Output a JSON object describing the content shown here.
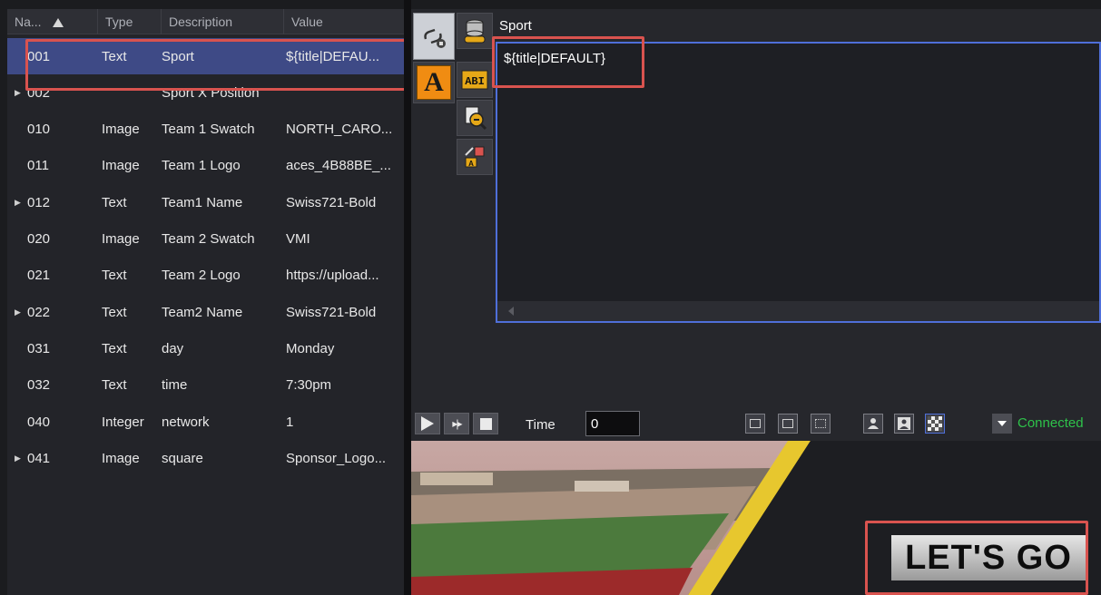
{
  "table": {
    "headers": {
      "name": "Na...",
      "type": "Type",
      "description": "Description",
      "value": "Value"
    },
    "rows": [
      {
        "name": "001",
        "expandable": false,
        "type": "Text",
        "description": "Sport",
        "value": "${title|DEFAU..."
      },
      {
        "name": "002",
        "expandable": true,
        "type": "",
        "description": "Sport X Position",
        "value": ""
      },
      {
        "name": "010",
        "expandable": false,
        "type": "Image",
        "description": "Team 1 Swatch",
        "value": "NORTH_CARO..."
      },
      {
        "name": "011",
        "expandable": false,
        "type": "Image",
        "description": "Team 1 Logo",
        "value": "aces_4B88BE_..."
      },
      {
        "name": "012",
        "expandable": true,
        "type": "Text",
        "description": "Team1 Name",
        "value": "Swiss721-Bold"
      },
      {
        "name": "020",
        "expandable": false,
        "type": "Image",
        "description": "Team 2 Swatch",
        "value": "VMI"
      },
      {
        "name": "021",
        "expandable": false,
        "type": "Text",
        "description": "Team 2 Logo",
        "value": "https://upload..."
      },
      {
        "name": "022",
        "expandable": true,
        "type": "Text",
        "description": "Team2 Name",
        "value": "Swiss721-Bold"
      },
      {
        "name": "031",
        "expandable": false,
        "type": "Text",
        "description": "day",
        "value": "Monday"
      },
      {
        "name": "032",
        "expandable": false,
        "type": "Text",
        "description": "time",
        "value": "7:30pm"
      },
      {
        "name": "040",
        "expandable": false,
        "type": "Integer",
        "description": "network",
        "value": "1"
      },
      {
        "name": "041",
        "expandable": true,
        "type": "Image",
        "description": "square",
        "value": "Sponsor_Logo..."
      }
    ]
  },
  "editor": {
    "field_label": "Sport",
    "text": "${title|DEFAULT}"
  },
  "tools": {
    "link_icon": "link-icon",
    "database_icon": "database-link-icon",
    "text_icon": "text-A-icon",
    "abc_icon": "abc-text-icon",
    "search_icon": "search-doc-icon",
    "replace_icon": "replace-icon"
  },
  "playback": {
    "time_label": "Time",
    "time_value": "0",
    "status": "Connected"
  },
  "preview": {
    "overlay_text": "LET'S GO"
  },
  "colors": {
    "selection": "#3e4a86",
    "highlight_box": "#d9534f",
    "editor_border": "#4f6fd9",
    "connected": "#2ec24a",
    "accent_yellow": "#e7c72e",
    "text_tool": "#f08c12"
  }
}
